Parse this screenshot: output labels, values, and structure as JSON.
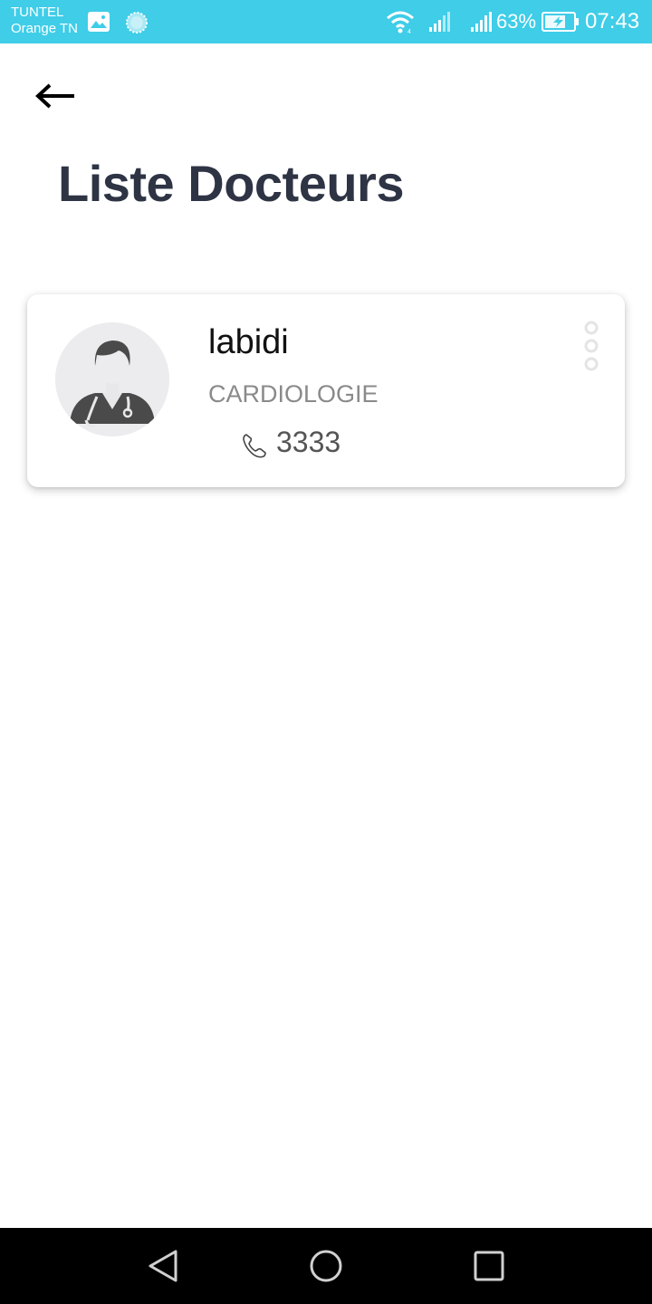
{
  "status_bar": {
    "carrier_line1": "TUNTEL",
    "carrier_line2": "Orange TN",
    "battery_percent": "63%",
    "time": "07:43",
    "icons": [
      "gallery-icon",
      "circle-notification-icon",
      "wifi-icon",
      "signal-icon",
      "signal-icon",
      "battery-charging-icon"
    ]
  },
  "header": {
    "back_icon": "arrow-left-icon",
    "title": "Liste Docteurs"
  },
  "doctors": [
    {
      "name": "labidi",
      "specialty": "CARDIOLOGIE",
      "phone": "3333",
      "avatar_icon": "doctor-avatar-icon",
      "phone_icon": "phone-icon",
      "menu_icon": "more-vertical-icon"
    }
  ],
  "nav_bar": {
    "buttons": [
      "nav-back-icon",
      "nav-home-icon",
      "nav-recent-icon"
    ]
  },
  "colors": {
    "status_bar": "#3fcde8",
    "title": "#2e3444",
    "specialty": "#8a8a8a",
    "nav_bar": "#000000"
  }
}
